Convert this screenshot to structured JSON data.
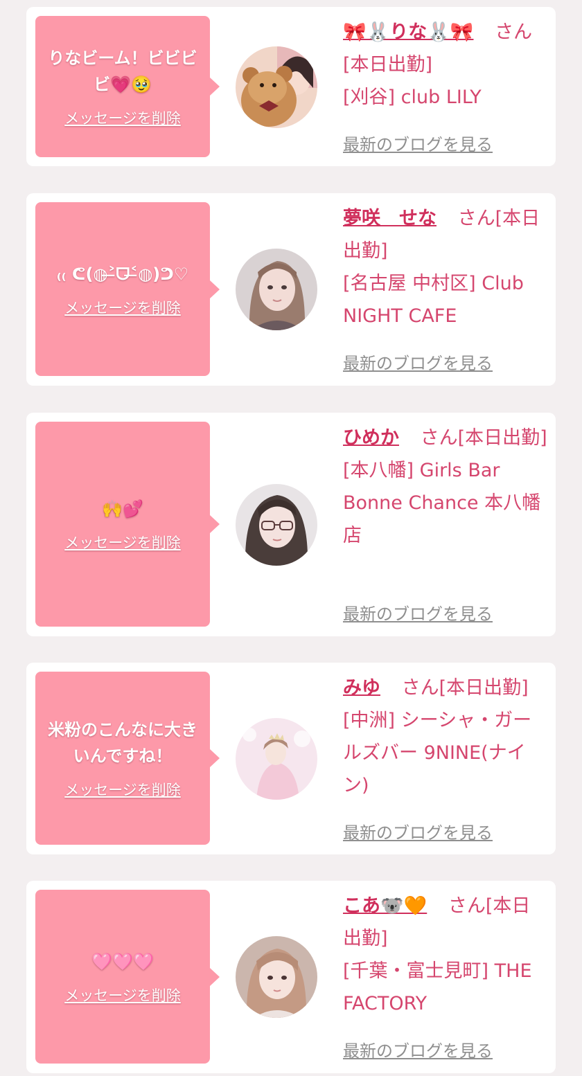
{
  "common": {
    "delete_label": "メッセージを削除",
    "blog_label": "最新のブログを見る",
    "name_suffix": "さん[本日出勤]"
  },
  "cards": [
    {
      "message": "りなビーム！ビビビビ💗🥹",
      "name": "🎀🐰りな🐰🎀",
      "shop": "[刈谷] club LILY",
      "avatar_icon": "girl-with-teddy-bear-photo"
    },
    {
      "message": "₍₍ ᕦ(◍˃̶ᗜ˂̶◍)ᕤ♡",
      "name": "夢咲　せな",
      "shop": "[名古屋 中村区] Club NIGHT CAFE",
      "avatar_icon": "girl-portrait-photo"
    },
    {
      "message": "🙌💕",
      "name": "ひめか",
      "shop": "[本八幡] Girls Bar Bonne Chance 本八幡店",
      "avatar_icon": "girl-with-glasses-photo"
    },
    {
      "message": "米粉のこんなに大きいんですね！",
      "name": "みゆ",
      "shop": "[中洲] シーシャ・ガールズバー 9NINE(ナイン)",
      "avatar_icon": "girl-in-pink-dress-photo"
    },
    {
      "message": "🩷🩷🩷",
      "name": "こあ🐨🧡",
      "shop": "[千葉・富士見町] THE FACTORY",
      "avatar_icon": "girl-portrait-photo"
    }
  ]
}
